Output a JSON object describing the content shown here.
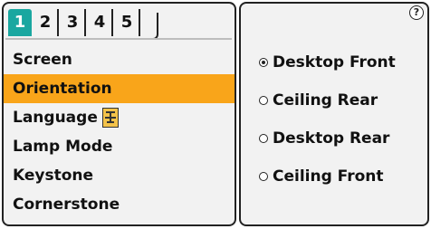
{
  "tabs": [
    {
      "label": "1",
      "active": true
    },
    {
      "label": "2",
      "active": false
    },
    {
      "label": "3",
      "active": false
    },
    {
      "label": "4",
      "active": false
    },
    {
      "label": "5",
      "active": false
    }
  ],
  "menu": {
    "items": [
      {
        "label": "Screen"
      },
      {
        "label": "Orientation",
        "selected": true
      },
      {
        "label": "Language",
        "icon": "language-flag-icon"
      },
      {
        "label": "Lamp Mode"
      },
      {
        "label": "Keystone"
      },
      {
        "label": "Cornerstone"
      }
    ]
  },
  "help": {
    "label": "?"
  },
  "options": [
    {
      "label": "Desktop Front",
      "checked": true
    },
    {
      "label": "Ceiling Rear",
      "checked": false
    },
    {
      "label": "Desktop Rear",
      "checked": false
    },
    {
      "label": "Ceiling Front",
      "checked": false
    }
  ],
  "colors": {
    "tab_active": "#1aa7a0",
    "menu_selected": "#f9a51a",
    "panel_bg": "#f2f2f2"
  }
}
